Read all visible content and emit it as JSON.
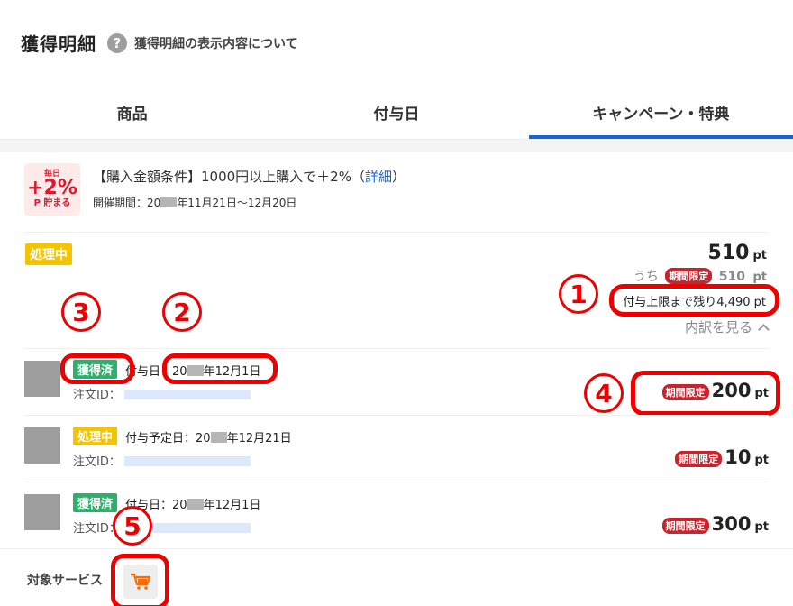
{
  "header": {
    "title": "獲得明細",
    "help_text": "獲得明細の表示内容について",
    "help_icon": "?"
  },
  "tabs": [
    {
      "label": "商品",
      "active": false
    },
    {
      "label": "付与日",
      "active": false
    },
    {
      "label": "キャンペーン・特典",
      "active": true
    }
  ],
  "campaign": {
    "badge": {
      "line1": "毎日",
      "line2": "+2%",
      "line3": "P 貯まる"
    },
    "title_prefix": "【購入金額条件】1000円以上購入で＋2%（",
    "title_link": "詳細",
    "title_suffix": "）",
    "period_prefix": "開催期間：20",
    "period_suffix": "年11月21日〜12月20日"
  },
  "summary": {
    "status": "処理中",
    "total_points": "510",
    "pt_unit": "pt",
    "uchi_label": "うち",
    "limit_label": "期間限定",
    "limited_points": "510",
    "remaining_text": "付与上限まで残り4,490 pt",
    "breakdown_label": "内訳を見る"
  },
  "items": [
    {
      "status": "獲得済",
      "date_prefix": "付与日：",
      "date_year": "20",
      "date_rest": "年12月1日",
      "order_label": "注文ID：",
      "limit_label": "期間限定",
      "points": "200",
      "pt_unit": "pt"
    },
    {
      "status": "処理中",
      "date_prefix": "付与予定日：",
      "date_year": "20",
      "date_rest": "年12月21日",
      "order_label": "注文ID：",
      "limit_label": "期間限定",
      "points": "10",
      "pt_unit": "pt"
    },
    {
      "status": "獲得済",
      "date_prefix": "付与日：",
      "date_year": "20",
      "date_rest": "年12月1日",
      "order_label": "注文ID：",
      "limit_label": "期間限定",
      "points": "300",
      "pt_unit": "pt"
    }
  ],
  "service": {
    "label": "対象サービス",
    "icon": "shopping-cart-icon"
  },
  "annotations": [
    "1",
    "2",
    "3",
    "4",
    "5"
  ],
  "colors": {
    "accent_blue": "#1565d8",
    "annotation_red": "#ee0000",
    "status_processing": "#f4c400",
    "status_done": "#2eb06a",
    "limited_tag": "#c7242e"
  }
}
